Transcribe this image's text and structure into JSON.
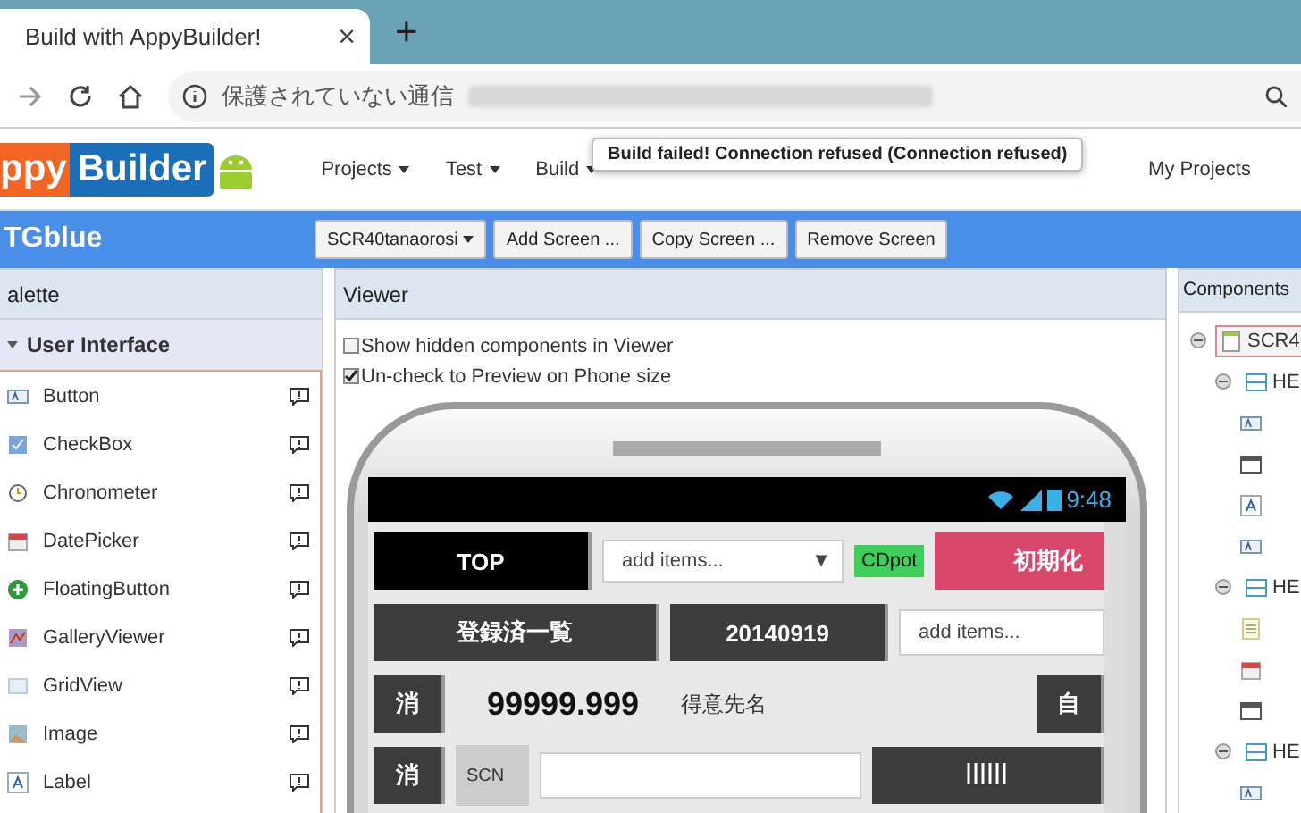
{
  "browser": {
    "tab_title": "Build with AppyBuilder!",
    "new_tab": "+",
    "close_tab": "×",
    "security_label": "保護されていない通信"
  },
  "header": {
    "logo": [
      "ppy",
      "Builder"
    ],
    "menu": [
      {
        "label": "Projects"
      },
      {
        "label": "Test"
      },
      {
        "label": "Build"
      }
    ],
    "my_projects": "My Projects",
    "toast": "Build failed! Connection refused (Connection refused)"
  },
  "project_bar": {
    "title": "TGblue",
    "screen_select": "SCR40tanaorosi",
    "buttons": [
      "Add Screen ...",
      "Copy Screen ...",
      "Remove Screen"
    ]
  },
  "palette": {
    "title": "alette",
    "section": {
      "label": "User Interface",
      "expanded": true
    },
    "items": [
      {
        "label": "Button",
        "kind": "button"
      },
      {
        "label": "CheckBox",
        "kind": "checkbox"
      },
      {
        "label": "Chronometer",
        "kind": "chronometer"
      },
      {
        "label": "DatePicker",
        "kind": "datepicker"
      },
      {
        "label": "FloatingButton",
        "kind": "floating"
      },
      {
        "label": "GalleryViewer",
        "kind": "gallery"
      },
      {
        "label": "GridView",
        "kind": "grid"
      },
      {
        "label": "Image",
        "kind": "image"
      },
      {
        "label": "Label",
        "kind": "label"
      }
    ]
  },
  "viewer": {
    "title": "Viewer",
    "options": [
      {
        "label": "Show hidden components in Viewer",
        "checked": false
      },
      {
        "label": "Un-check to Preview on Phone size",
        "checked": true
      }
    ],
    "phone": {
      "time": "9:48",
      "top_button": "TOP",
      "dropdown": "add items...",
      "dropdown_caret": "▼",
      "cdpot": "CDpot",
      "reset_button": "初期化",
      "list_button": "登録済一覧",
      "date_button": "20140919",
      "items_field": "add items...",
      "clear_button": "消",
      "amount": "99999.999",
      "customer_label": "得意先名",
      "own_button": "自",
      "clear_button_2": "消",
      "scn_label": "SCN"
    }
  },
  "components": {
    "title": "Components",
    "tree": [
      {
        "label": "SCR4",
        "kind": "screen",
        "expanded": true,
        "selected": true,
        "children": [
          {
            "label": "HE",
            "kind": "arrangement",
            "expanded": true,
            "selected": false,
            "children": [
              {
                "kind": "button"
              },
              {
                "kind": "spinner"
              },
              {
                "kind": "label"
              },
              {
                "kind": "button"
              }
            ]
          },
          {
            "label": "HE",
            "kind": "arrangement",
            "expanded": true,
            "selected": false,
            "children": [
              {
                "kind": "listview"
              },
              {
                "kind": "datepicker"
              },
              {
                "kind": "spinner"
              }
            ]
          },
          {
            "label": "HE",
            "kind": "arrangement",
            "expanded": true,
            "selected": false,
            "children": [
              {
                "kind": "button"
              }
            ]
          }
        ]
      }
    ]
  }
}
